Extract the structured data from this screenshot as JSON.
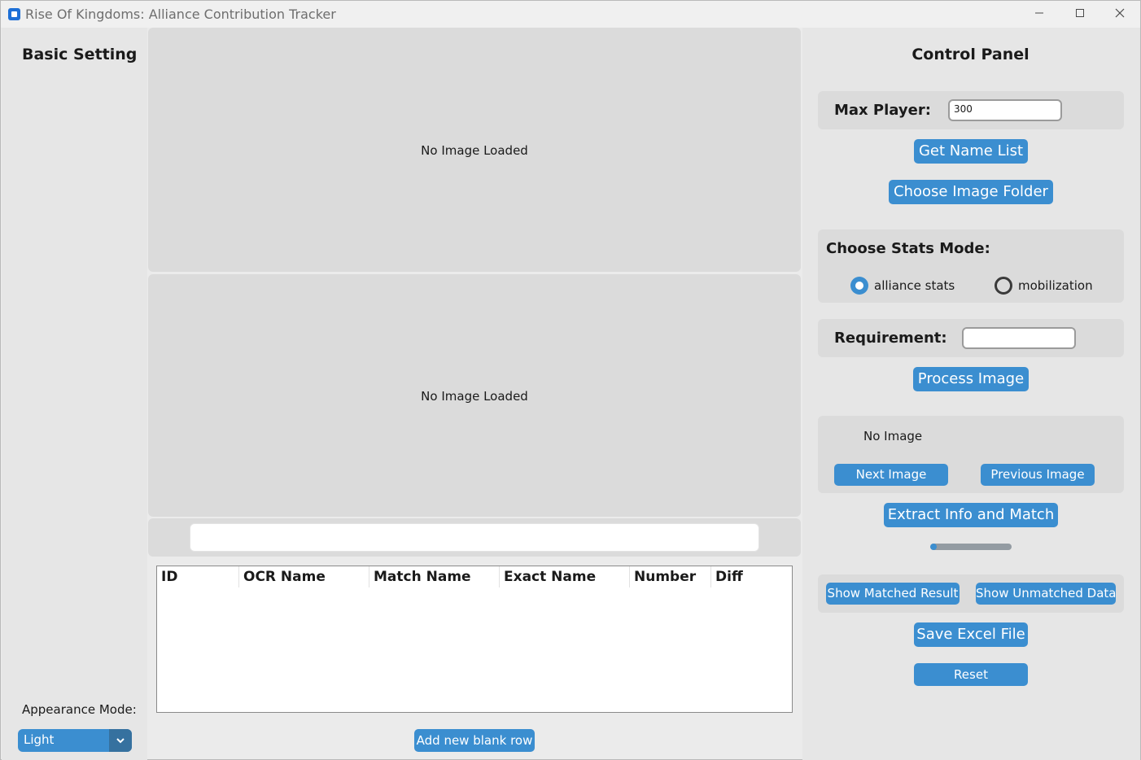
{
  "window": {
    "title": "Rise Of Kingdoms: Alliance Contribution Tracker",
    "minimize_glyph": "—",
    "maximize_glyph": "☐",
    "close_glyph": "✕"
  },
  "sidebar": {
    "title": "Basic Setting",
    "appearance_label": "Appearance Mode:",
    "appearance_value": "Light",
    "dropdown_icon": "chevron-down-icon"
  },
  "center": {
    "image_top_message": "No Image Loaded",
    "image_bottom_message": "No Image Loaded",
    "ocr_text_value": "",
    "table": {
      "columns": [
        "ID",
        "OCR Name",
        "Match Name",
        "Exact Name",
        "Number",
        "Diff"
      ],
      "rows": []
    },
    "add_row_label": "Add new blank row"
  },
  "control_panel": {
    "title": "Control Panel",
    "max_player_label": "Max Player:",
    "max_player_value": "300",
    "get_name_list_label": "Get Name List",
    "choose_folder_label": "Choose Image Folder",
    "stats_mode_label": "Choose Stats Mode:",
    "stats_modes": [
      {
        "label": "alliance stats",
        "selected": true
      },
      {
        "label": "mobilization",
        "selected": false
      }
    ],
    "requirement_label": "Requirement:",
    "requirement_value": "",
    "process_image_label": "Process Image",
    "image_status": "No Image",
    "next_image_label": "Next Image",
    "previous_image_label": "Previous Image",
    "extract_label": "Extract Info and Match",
    "progress_fraction": 0.08,
    "show_matched_label": "Show Matched Result",
    "show_unmatched_label": "Show Unmatched Data",
    "save_excel_label": "Save Excel File",
    "reset_label": "Reset"
  },
  "colors": {
    "accent": "#3b8ed0",
    "accent_dark": "#36719f",
    "frame": "#dbdbdb",
    "panel": "#e6e6e6"
  }
}
